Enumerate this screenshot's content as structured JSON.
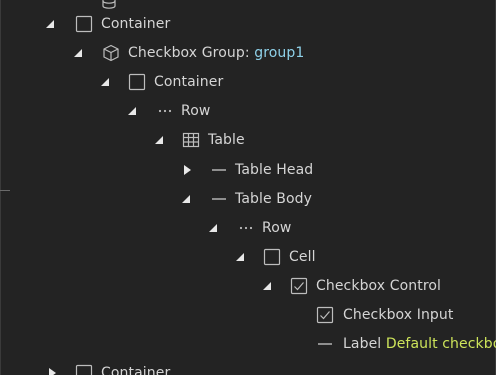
{
  "tree": {
    "rows": [
      {
        "label": "",
        "value": "",
        "icon": "database-icon",
        "disclosure": "none"
      },
      {
        "label": "Container",
        "value": "",
        "icon": "container-icon",
        "disclosure": "expanded"
      },
      {
        "label": "Checkbox Group:",
        "value": "group1",
        "icon": "cube-icon",
        "disclosure": "expanded"
      },
      {
        "label": "Container",
        "value": "",
        "icon": "container-icon",
        "disclosure": "expanded"
      },
      {
        "label": "Row",
        "value": "",
        "icon": "row-icon",
        "disclosure": "expanded"
      },
      {
        "label": "Table",
        "value": "",
        "icon": "table-icon",
        "disclosure": "expanded"
      },
      {
        "label": "Table Head",
        "value": "",
        "icon": "dash-icon",
        "disclosure": "collapsed"
      },
      {
        "label": "Table Body",
        "value": "",
        "icon": "dash-icon",
        "disclosure": "expanded"
      },
      {
        "label": "Row",
        "value": "",
        "icon": "row-icon",
        "disclosure": "expanded"
      },
      {
        "label": "Cell",
        "value": "",
        "icon": "container-icon",
        "disclosure": "expanded"
      },
      {
        "label": "Checkbox Control",
        "value": "",
        "icon": "checkbox-icon",
        "disclosure": "expanded"
      },
      {
        "label": "Checkbox Input",
        "value": "",
        "icon": "checkbox-icon",
        "disclosure": "none"
      },
      {
        "label": "Label",
        "value": "Default checkbox",
        "icon": "dash-icon",
        "disclosure": "none"
      },
      {
        "label": "Container",
        "value": "",
        "icon": "container-icon",
        "disclosure": "collapsed"
      }
    ]
  },
  "colors": {
    "background": "#232323",
    "text": "#d5d5d5",
    "icon": "#bdbdbd",
    "value_blue": "#8fd2ea",
    "value_green": "#cde45a"
  }
}
